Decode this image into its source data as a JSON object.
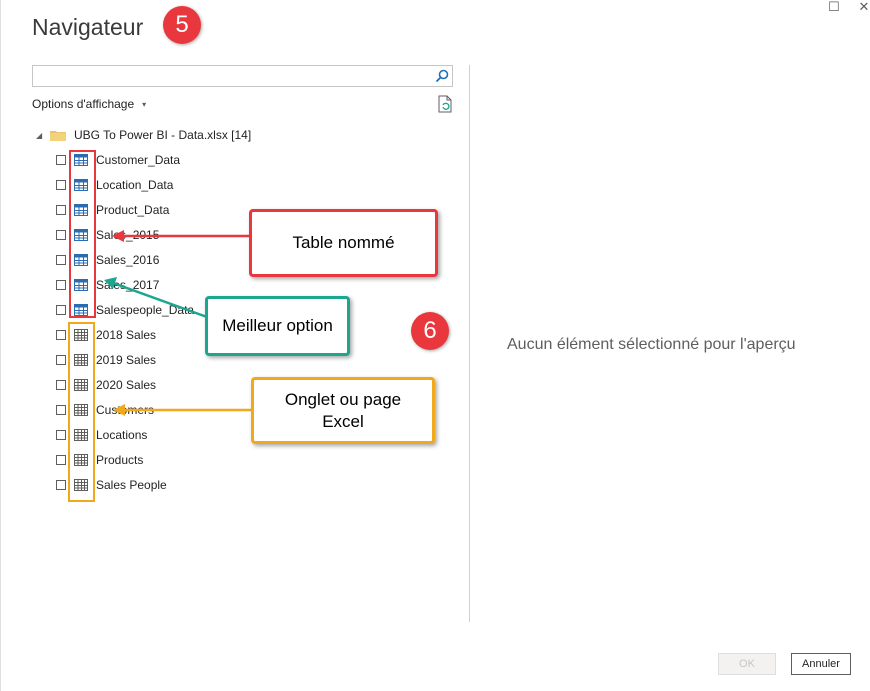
{
  "window": {
    "title": "Navigateur",
    "maximize_glyph": "☐",
    "close_glyph": "✕"
  },
  "search": {
    "value": "",
    "placeholder": ""
  },
  "options": {
    "label": "Options d'affichage",
    "caret": "▾"
  },
  "tree": {
    "root_label": "UBG To Power BI - Data.xlsx [14]",
    "expand_glyph": "◢",
    "tables": [
      "Customer_Data",
      "Location_Data",
      "Product_Data",
      "Sales_2015",
      "Sales_2016",
      "Sales_2017",
      "Salespeople_Data"
    ],
    "sheets": [
      "2018 Sales",
      "2019 Sales",
      "2020 Sales",
      "Customers",
      "Locations",
      "Products",
      "Sales People"
    ]
  },
  "preview": {
    "empty_text": "Aucun élément sélectionné pour l'aperçu"
  },
  "buttons": {
    "ok": "OK",
    "cancel": "Annuler"
  },
  "annotations": {
    "badge_5": "5",
    "badge_6": "6",
    "table_callout": "Table nommé",
    "best_callout": "Meilleur option",
    "sheet_callout_line1": "Onglet ou page",
    "sheet_callout_line2": "Excel"
  },
  "colors": {
    "red": "#e8383d",
    "teal": "#1aa68f",
    "orange": "#f0a81c",
    "table_icon_blue": "#2b6cb0"
  }
}
